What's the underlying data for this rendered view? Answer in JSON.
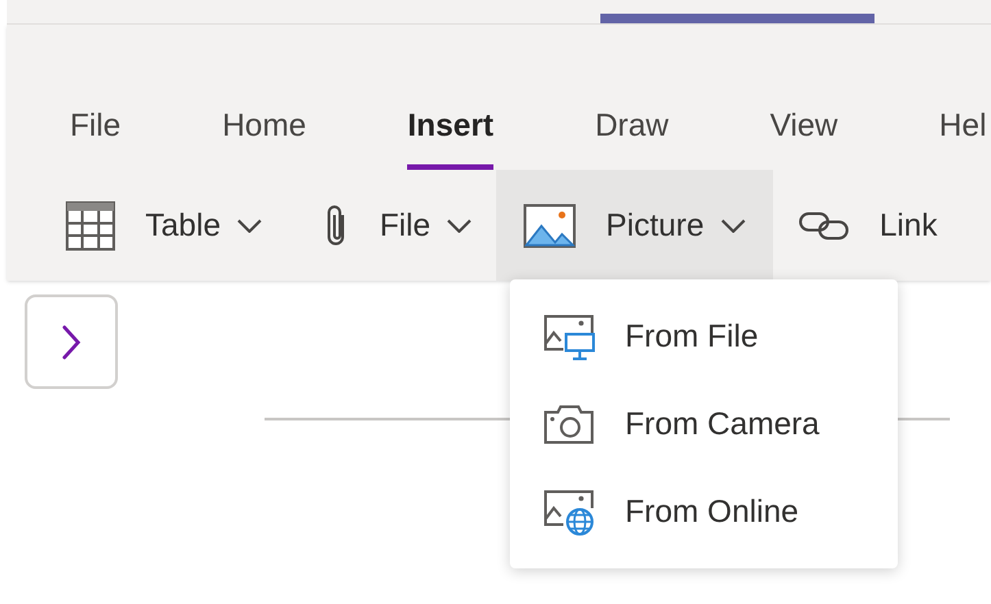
{
  "tabs": [
    {
      "label": "File",
      "selected": false
    },
    {
      "label": "Home",
      "selected": false
    },
    {
      "label": "Insert",
      "selected": true
    },
    {
      "label": "Draw",
      "selected": false
    },
    {
      "label": "View",
      "selected": false
    },
    {
      "label": "Hel",
      "selected": false
    }
  ],
  "toolbar": [
    {
      "kind": "table",
      "label": "Table",
      "dropdown": true,
      "expanded": false
    },
    {
      "kind": "attach",
      "label": "File",
      "dropdown": true,
      "expanded": false
    },
    {
      "kind": "picture",
      "label": "Picture",
      "dropdown": true,
      "expanded": true
    },
    {
      "kind": "link",
      "label": "Link",
      "dropdown": false,
      "expanded": false
    }
  ],
  "menu": [
    {
      "kind": "file",
      "label": "From File"
    },
    {
      "kind": "camera",
      "label": "From Camera"
    },
    {
      "kind": "online",
      "label": "From Online"
    }
  ]
}
